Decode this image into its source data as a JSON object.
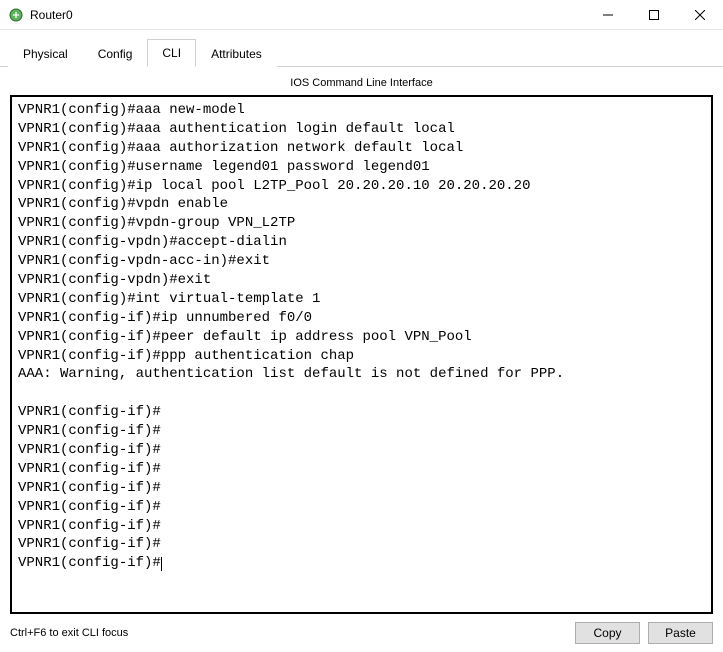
{
  "window": {
    "title": "Router0"
  },
  "tabs": {
    "physical": "Physical",
    "config": "Config",
    "cli": "CLI",
    "attributes": "Attributes"
  },
  "cli": {
    "header": "IOS Command Line Interface",
    "lines": [
      "VPNR1(config)#aaa new-model",
      "VPNR1(config)#aaa authentication login default local",
      "VPNR1(config)#aaa authorization network default local",
      "VPNR1(config)#username legend01 password legend01",
      "VPNR1(config)#ip local pool L2TP_Pool 20.20.20.10 20.20.20.20",
      "VPNR1(config)#vpdn enable",
      "VPNR1(config)#vpdn-group VPN_L2TP",
      "VPNR1(config-vpdn)#accept-dialin",
      "VPNR1(config-vpdn-acc-in)#exit",
      "VPNR1(config-vpdn)#exit",
      "VPNR1(config)#int virtual-template 1",
      "VPNR1(config-if)#ip unnumbered f0/0",
      "VPNR1(config-if)#peer default ip address pool VPN_Pool",
      "VPNR1(config-if)#ppp authentication chap",
      "AAA: Warning, authentication list default is not defined for PPP.",
      "",
      "VPNR1(config-if)#",
      "VPNR1(config-if)#",
      "VPNR1(config-if)#",
      "VPNR1(config-if)#",
      "VPNR1(config-if)#",
      "VPNR1(config-if)#",
      "VPNR1(config-if)#",
      "VPNR1(config-if)#",
      "VPNR1(config-if)#"
    ]
  },
  "footer": {
    "hint": "Ctrl+F6 to exit CLI focus",
    "copy": "Copy",
    "paste": "Paste"
  }
}
